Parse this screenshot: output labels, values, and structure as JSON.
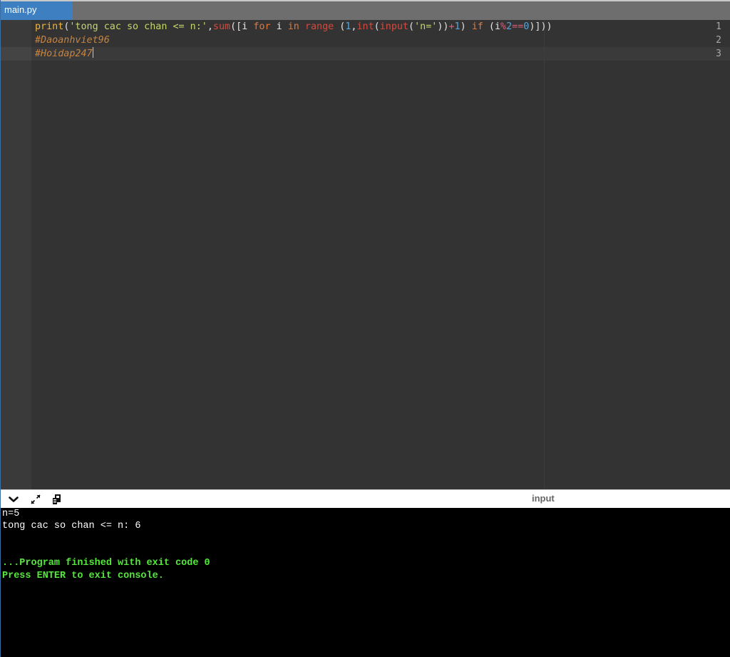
{
  "tabs": [
    {
      "label": "main.py",
      "active": true
    }
  ],
  "editor": {
    "line_numbers": [
      "1",
      "2",
      "3"
    ],
    "line1": {
      "t1": "print",
      "t2": "(",
      "t3": "'tong cac so chan <= n:'",
      "t4": ",",
      "t5": "sum",
      "t6": "([",
      "t7": "i ",
      "t8": "for",
      "t9": " i ",
      "t10": "in",
      "t11": " ",
      "t12": "range",
      "t13": " (",
      "t14": "1",
      "t15": ",",
      "t16": "int",
      "t17": "(",
      "t18": "input",
      "t19": "(",
      "t20": "'n='",
      "t21": "))",
      "t22": "+",
      "t23": "1",
      "t24": ") ",
      "t25": "if",
      "t26": " (i",
      "t27": "%",
      "t28": "2",
      "t29": "==",
      "t30": "0",
      "t31": ")]))"
    },
    "line2": "#Daoanhviet96",
    "line3": "#Hoidap247"
  },
  "console_toolbar": {
    "input_label": "input"
  },
  "console": {
    "lines": [
      "n=5",
      "tong cac so chan <= n: 6",
      "",
      "",
      "...Program finished with exit code 0",
      "Press ENTER to exit console."
    ]
  },
  "colors": {
    "tab_active": "#3d7fc1",
    "editor_bg": "#333333",
    "console_bg": "#000000",
    "console_success": "#54e93a"
  }
}
